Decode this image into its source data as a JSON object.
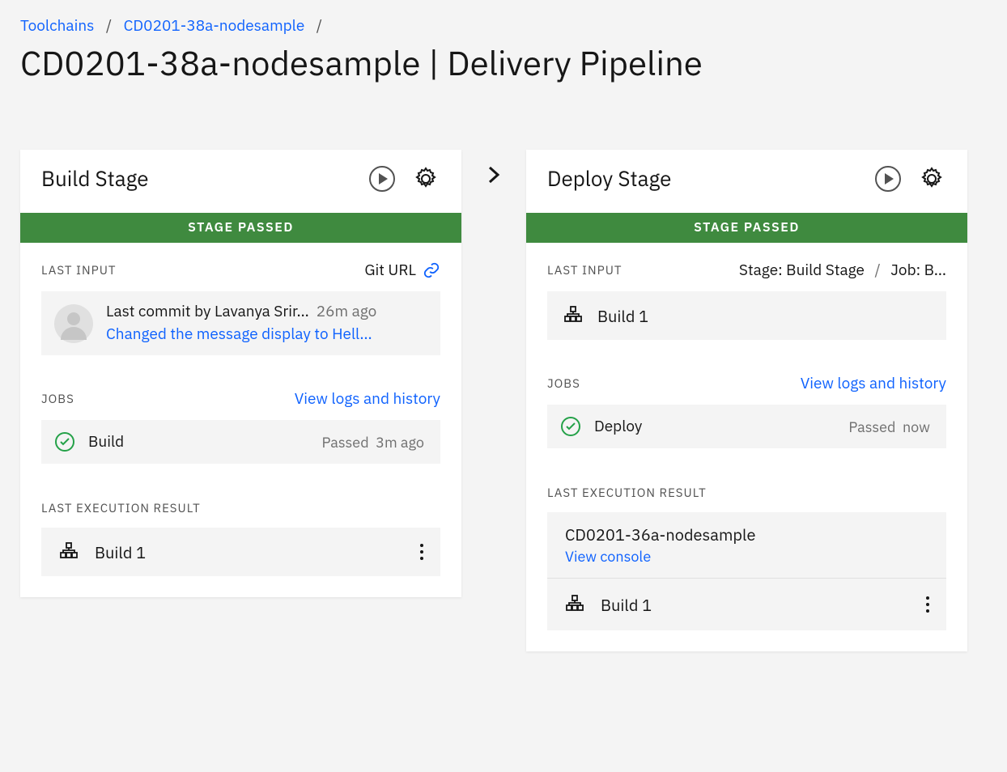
{
  "breadcrumb": {
    "item1": "Toolchains",
    "item2": "CD0201-38a-nodesample"
  },
  "page_title": "CD0201-38a-nodesample | Delivery Pipeline",
  "labels": {
    "last_input": "LAST INPUT",
    "jobs": "JOBS",
    "view_logs": "View logs and history",
    "last_exec": "LAST EXECUTION RESULT",
    "git_url": "Git URL"
  },
  "stages": {
    "build": {
      "title": "Build Stage",
      "status": "STAGE PASSED",
      "commit_by_prefix": "Last commit by ",
      "commit_author": "Lavanya Srir…",
      "commit_time": "26m ago",
      "commit_msg": "Changed the message display to Hell…",
      "job_name": "Build",
      "job_status": "Passed",
      "job_time": "3m ago",
      "result": "Build 1"
    },
    "deploy": {
      "title": "Deploy Stage",
      "status": "STAGE PASSED",
      "input_stage_label": "Stage: Build Stage",
      "input_job_label": "Job: B…",
      "input_build": "Build 1",
      "job_name": "Deploy",
      "job_status": "Passed",
      "job_time": "now",
      "app_name": "CD0201-36a-nodesample",
      "view_console": "View console",
      "result": "Build 1"
    }
  }
}
